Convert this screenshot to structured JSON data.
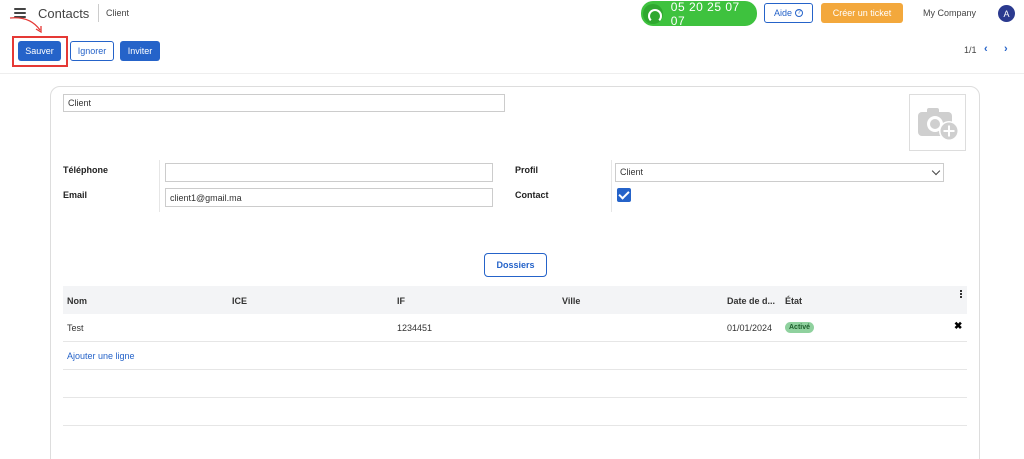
{
  "header": {
    "app_title": "Contacts",
    "breadcrumb": "Client",
    "phone": "05 20 25 07 07",
    "help_label": "Aide",
    "ticket_label": "Créer un ticket",
    "company": "My Company",
    "avatar_initial": "A"
  },
  "actions": {
    "save_label": "Sauver",
    "ignore_label": "Ignorer",
    "invite_label": "Inviter",
    "pager": "1/1"
  },
  "form": {
    "name_value": "Client",
    "phone_label": "Téléphone",
    "phone_value": "",
    "email_label": "Email",
    "email_value": "client1@gmail.ma",
    "profile_label": "Profil",
    "profile_value": "Client",
    "contact_label": "Contact",
    "contact_checked": true,
    "dossiers_label": "Dossiers"
  },
  "table": {
    "columns": [
      "Nom",
      "ICE",
      "IF",
      "Ville",
      "Date de d...",
      "État"
    ],
    "rows": [
      {
        "nom": "Test",
        "ice": "",
        "if": "1234451",
        "ville": "",
        "date": "01/01/2024",
        "etat": "Activé"
      }
    ],
    "add_line_label": "Ajouter une ligne"
  },
  "colors": {
    "primary": "#2563c9",
    "phone_green": "#3ec23e",
    "ticket_orange": "#f3a83c",
    "highlight_red": "#e53935",
    "badge_green": "#8fd19e"
  }
}
